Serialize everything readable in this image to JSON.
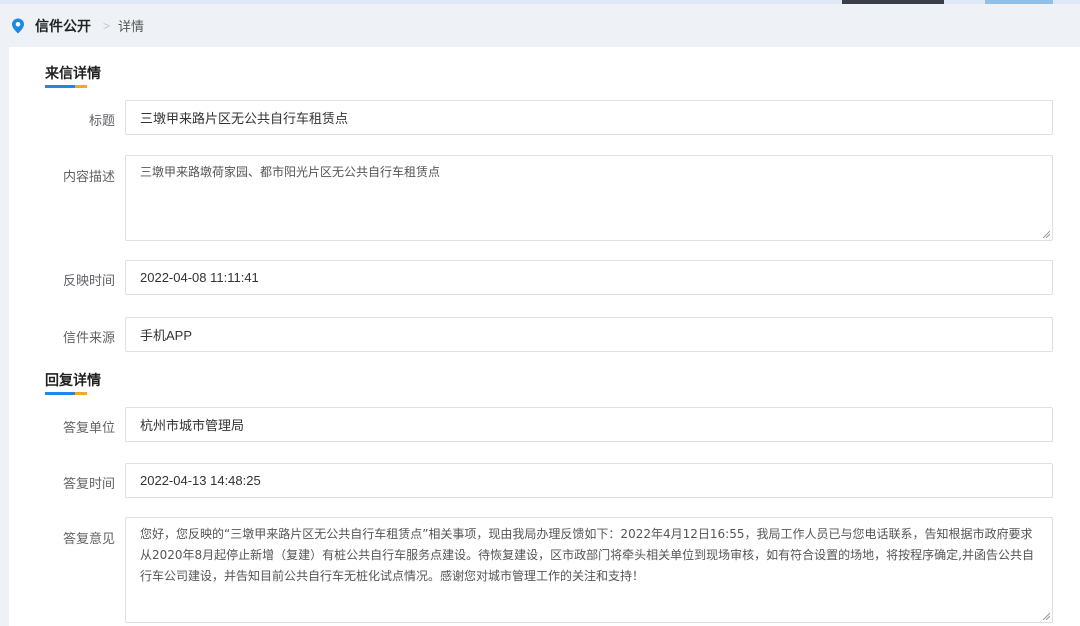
{
  "breadcrumb": {
    "home": "信件公开",
    "current": "详情"
  },
  "letter": {
    "section_title": "来信详情",
    "title_label": "标题",
    "title_value": "三墩甲来路片区无公共自行车租赁点",
    "desc_label": "内容描述",
    "desc_value": "三墩甲来路墩荷家园、都市阳光片区无公共自行车租赁点",
    "time_label": "反映时间",
    "time_value": "2022-04-08 11:11:41",
    "source_label": "信件来源",
    "source_value": "手机APP"
  },
  "reply": {
    "section_title": "回复详情",
    "unit_label": "答复单位",
    "unit_value": "杭州市城市管理局",
    "time_label": "答复时间",
    "time_value": "2022-04-13 14:48:25",
    "opinion_label": "答复意见",
    "opinion_value": "您好，您反映的“三墩甲来路片区无公共自行车租赁点”相关事项，现由我局办理反馈如下：2022年4月12日16:55，我局工作人员已与您电话联系，告知根据市政府要求从2020年8月起停止新增（复建）有桩公共自行车服务点建设。待恢复建设，区市政部门将牵头相关单位到现场审核，如有符合设置的场地，将按程序确定,并函告公共自行车公司建设，并告知目前公共自行车无桩化试点情况。感谢您对城市管理工作的关注和支持！"
  },
  "colors": {
    "accent_blue": "#1e88e5",
    "accent_orange": "#f5a623",
    "page_bg": "#eef2f7"
  },
  "icons": {
    "breadcrumb_icon": "location-pin-icon",
    "separator": "chevron-right-icon"
  }
}
